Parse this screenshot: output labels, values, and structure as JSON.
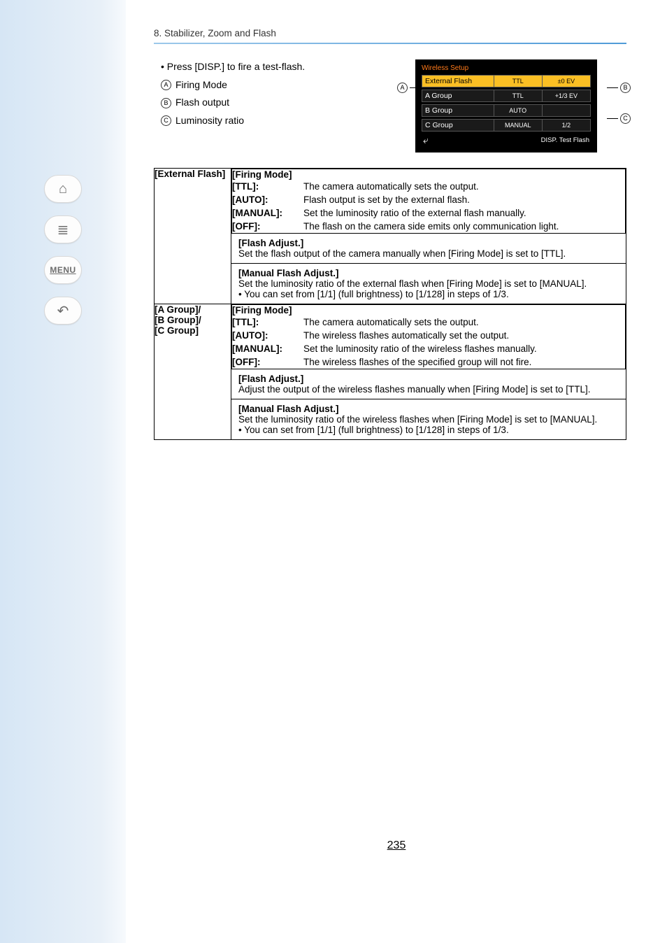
{
  "nav": {
    "home_icon": "⌂",
    "toc_icon": "≣",
    "menu_label": "MENU",
    "back_icon": "↶"
  },
  "breadcrumb": "8. Stabilizer, Zoom and Flash",
  "intro": {
    "bullet": "• Press [DISP.] to fire a test-flash.",
    "legend_a_letter": "A",
    "legend_a_text": "Firing Mode",
    "legend_b_letter": "B",
    "legend_b_text": "Flash output",
    "legend_c_letter": "C",
    "legend_c_text": "Luminosity ratio"
  },
  "figure": {
    "title": "Wireless Setup",
    "rows": [
      {
        "name": "External Flash",
        "mode": "TTL",
        "out": "±0 EV"
      },
      {
        "name": "A Group",
        "mode": "TTL",
        "out": "+1/3 EV"
      },
      {
        "name": "B Group",
        "mode": "AUTO",
        "out": ""
      },
      {
        "name": "C Group",
        "mode": "MANUAL",
        "out": "1/2"
      }
    ],
    "back": "⤶",
    "foot": "DISP. Test Flash",
    "ann_a": "A",
    "ann_b": "B",
    "ann_c": "C"
  },
  "table": {
    "ext_label": "[External Flash]",
    "grp_label_a": "[A Group]/",
    "grp_label_b": "[B Group]/",
    "grp_label_c": "[C Group]",
    "firing_mode_head": "[Firing Mode]",
    "ttl_key": "[TTL]:",
    "auto_key": "[AUTO]:",
    "manual_key": "[MANUAL]:",
    "off_key": "[OFF]:",
    "ext": {
      "ttl": "The camera automatically sets the output.",
      "auto": "Flash output is set by the external flash.",
      "manual": "Set the luminosity ratio of the external flash manually.",
      "off": "The flash on the camera side emits only communication light.",
      "fa_head": "[Flash Adjust.]",
      "fa_body": "Set the flash output of the camera manually when [Firing Mode] is set to [TTL].",
      "mfa_head": "[Manual Flash Adjust.]",
      "mfa_body1": "Set the luminosity ratio of the external flash when [Firing Mode] is set to [MANUAL].",
      "mfa_note": "• You can set from [1/1] (full brightness) to [1/128] in steps of 1/3."
    },
    "grp": {
      "ttl": "The camera automatically sets the output.",
      "auto": "The wireless flashes automatically set the output.",
      "manual": "Set the luminosity ratio of the wireless flashes manually.",
      "off": "The wireless flashes of the specified group will not fire.",
      "fa_head": "[Flash Adjust.]",
      "fa_body": "Adjust the output of the wireless flashes manually when [Firing Mode] is set to [TTL].",
      "mfa_head": "[Manual Flash Adjust.]",
      "mfa_body1": "Set the luminosity ratio of the wireless flashes when [Firing Mode] is set to [MANUAL].",
      "mfa_note": "• You can set from [1/1] (full brightness) to [1/128] in steps of 1/3."
    }
  },
  "page_number": "235"
}
